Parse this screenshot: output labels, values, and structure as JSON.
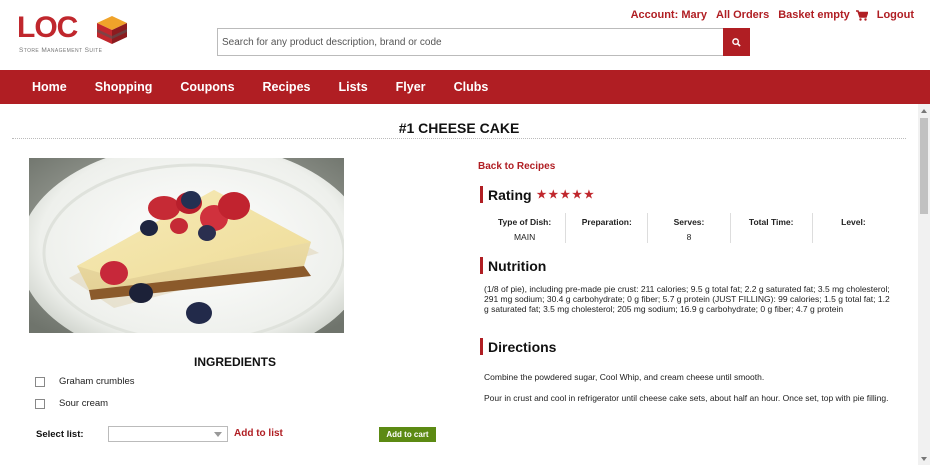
{
  "brand": {
    "logo_text": "LOC",
    "tagline": "Store Management Suite"
  },
  "account_links": {
    "account": "Account: Mary",
    "orders": "All Orders",
    "basket": "Basket empty",
    "logout": "Logout"
  },
  "search": {
    "placeholder": "Search for any product description, brand or code"
  },
  "nav": {
    "items": [
      "Home",
      "Shopping",
      "Coupons",
      "Recipes",
      "Lists",
      "Flyer",
      "Clubs"
    ]
  },
  "recipe": {
    "title": "#1 CHEESE CAKE",
    "back_link": "Back to Recipes",
    "rating_heading": "Rating",
    "rating_stars": 5,
    "rating_display": "★★★★★",
    "meta": [
      {
        "label": "Type of Dish:",
        "value": "MAIN"
      },
      {
        "label": "Preparation:",
        "value": ""
      },
      {
        "label": "Serves:",
        "value": "8"
      },
      {
        "label": "Total Time:",
        "value": ""
      },
      {
        "label": "Level:",
        "value": ""
      }
    ],
    "nutrition_heading": "Nutrition",
    "nutrition_text": "(1/8 of pie), including pre-made pie crust: 211 calories; 9.5 g total fat; 2.2 g saturated fat; 3.5 mg cholesterol; 291 mg sodium; 30.4 g carbohydrate; 0 g fiber; 5.7 g protein (JUST FILLING): 99 calories; 1.5 g total fat; 1.2 g saturated fat; 3.5 mg cholesterol; 205 mg sodium; 16.9 g carbohydrate; 0 g fiber; 4.7 g protein",
    "directions_heading": "Directions",
    "directions": [
      "Combine the powdered sugar, Cool Whip, and cream cheese until smooth.",
      "Pour in crust and cool in refrigerator until cheese cake sets, about half an hour. Once set, top with pie filling."
    ]
  },
  "ingredients": {
    "heading": "INGREDIENTS",
    "items": [
      {
        "label": "Graham crumbles",
        "checked": false
      },
      {
        "label": "Sour cream",
        "checked": false
      }
    ],
    "select_label": "Select list:",
    "select_value": "",
    "add_to_list": "Add to list",
    "add_to_cart": "Add to cart"
  },
  "colors": {
    "brand_red": "#b01e23",
    "cart_green": "#5c8a13"
  }
}
